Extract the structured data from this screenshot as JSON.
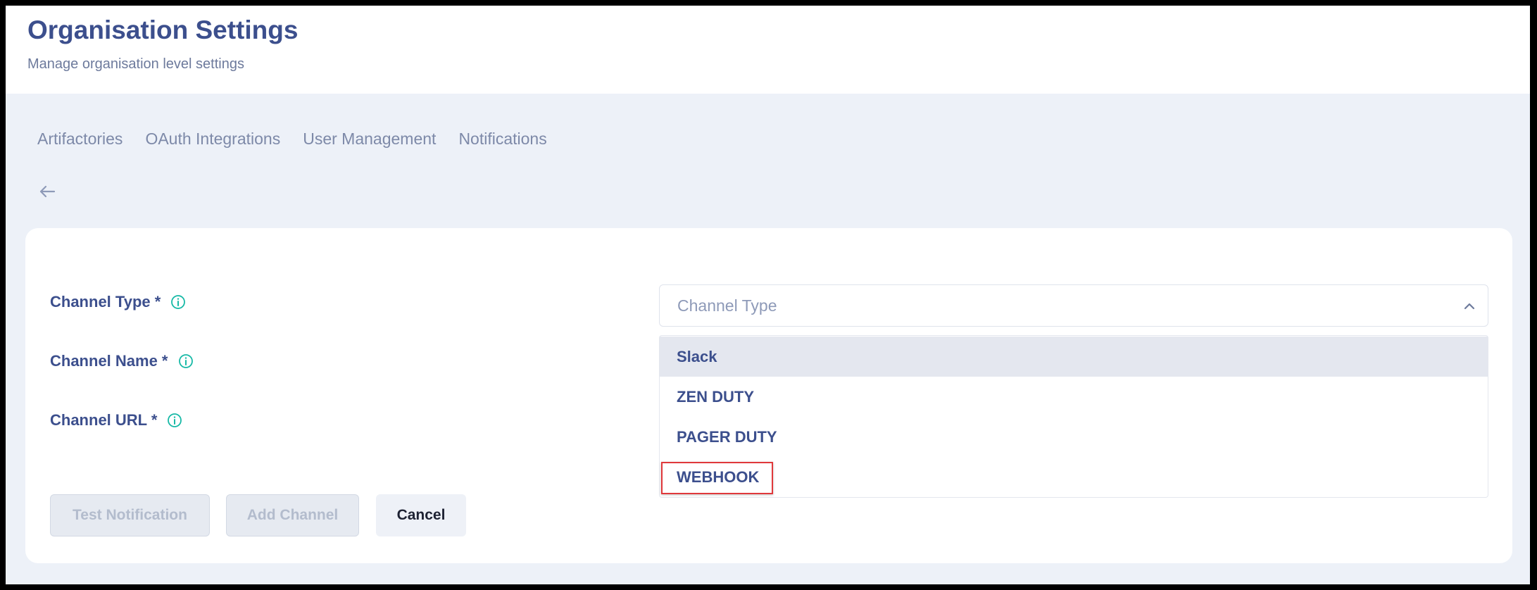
{
  "header": {
    "title": "Organisation Settings",
    "subtitle": "Manage organisation level settings"
  },
  "tabs": [
    {
      "label": "Artifactories"
    },
    {
      "label": "OAuth Integrations"
    },
    {
      "label": "User Management"
    },
    {
      "label": "Notifications"
    }
  ],
  "form": {
    "fields": [
      {
        "label": "Channel Type *"
      },
      {
        "label": "Channel Name *"
      },
      {
        "label": "Channel URL *"
      }
    ],
    "channel_type_select": {
      "placeholder": "Channel Type",
      "options": [
        "Slack",
        "ZEN DUTY",
        "PAGER DUTY",
        "WEBHOOK"
      ],
      "active_option": "Slack",
      "highlighted_option": "WEBHOOK"
    },
    "buttons": {
      "test_notification": "Test Notification",
      "add_channel": "Add Channel",
      "cancel": "Cancel"
    }
  },
  "icons": {
    "back": "arrow-left-icon",
    "info": "info-icon",
    "chevron": "chevron-up-icon"
  },
  "colors": {
    "primary_text": "#3c4f8d",
    "info_icon": "#17b9a6",
    "highlight_border": "#e0383b",
    "background": "#edf1f8"
  }
}
